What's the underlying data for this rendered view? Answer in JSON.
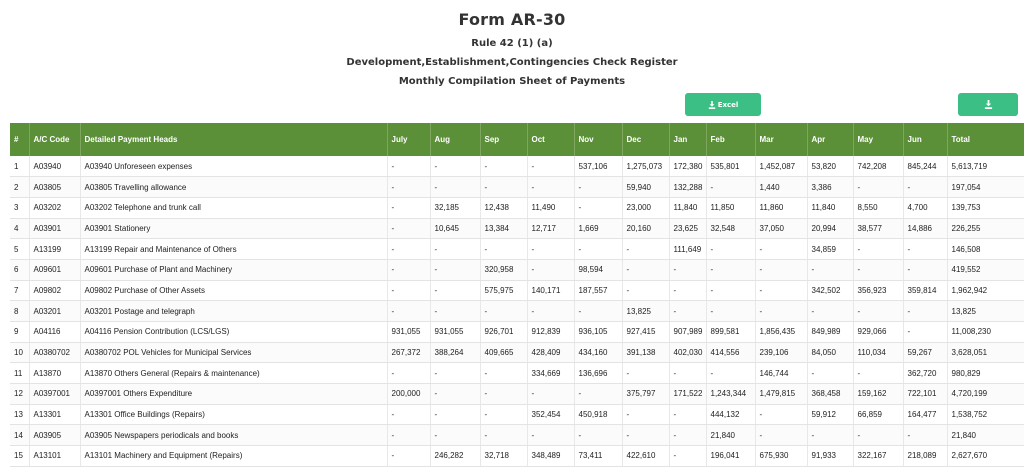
{
  "header": {
    "title": "Form AR-30",
    "rule": "Rule 42 (1) (a)",
    "register": "Development,Establishment,Contingencies Check Register",
    "sheet": "Monthly Compilation Sheet of Payments"
  },
  "toolbar": {
    "excel_label": "Excel",
    "excel_icon": "download-icon",
    "download_icon": "download-icon",
    "accent_color": "#3bbf84"
  },
  "table": {
    "header_color": "#5b8f38",
    "columns": [
      "#",
      "A/C Code",
      "Detailed Payment Heads",
      "July",
      "Aug",
      "Sep",
      "Oct",
      "Nov",
      "Dec",
      "Jan",
      "Feb",
      "Mar",
      "Apr",
      "May",
      "Jun",
      "Total"
    ],
    "rows": [
      [
        "1",
        "A03940",
        "A03940 Unforeseen expenses",
        "-",
        "-",
        "-",
        "-",
        "537,106",
        "1,275,073",
        "172,380",
        "535,801",
        "1,452,087",
        "53,820",
        "742,208",
        "845,244",
        "5,613,719"
      ],
      [
        "2",
        "A03805",
        "A03805 Travelling allowance",
        "-",
        "-",
        "-",
        "-",
        "-",
        "59,940",
        "132,288",
        "-",
        "1,440",
        "3,386",
        "-",
        "-",
        "197,054"
      ],
      [
        "3",
        "A03202",
        "A03202 Telephone and trunk call",
        "-",
        "32,185",
        "12,438",
        "11,490",
        "-",
        "23,000",
        "11,840",
        "11,850",
        "11,860",
        "11,840",
        "8,550",
        "4,700",
        "139,753"
      ],
      [
        "4",
        "A03901",
        "A03901 Stationery",
        "-",
        "10,645",
        "13,384",
        "12,717",
        "1,669",
        "20,160",
        "23,625",
        "32,548",
        "37,050",
        "20,994",
        "38,577",
        "14,886",
        "226,255"
      ],
      [
        "5",
        "A13199",
        "A13199 Repair and Maintenance of Others",
        "-",
        "-",
        "-",
        "-",
        "-",
        "-",
        "111,649",
        "-",
        "-",
        "34,859",
        "-",
        "-",
        "146,508"
      ],
      [
        "6",
        "A09601",
        "A09601 Purchase of Plant and Machinery",
        "-",
        "-",
        "320,958",
        "-",
        "98,594",
        "-",
        "-",
        "-",
        "-",
        "-",
        "-",
        "-",
        "419,552"
      ],
      [
        "7",
        "A09802",
        "A09802 Purchase of Other Assets",
        "-",
        "-",
        "575,975",
        "140,171",
        "187,557",
        "-",
        "-",
        "-",
        "-",
        "342,502",
        "356,923",
        "359,814",
        "1,962,942"
      ],
      [
        "8",
        "A03201",
        "A03201 Postage and telegraph",
        "-",
        "-",
        "-",
        "-",
        "-",
        "13,825",
        "-",
        "-",
        "-",
        "-",
        "-",
        "-",
        "13,825"
      ],
      [
        "9",
        "A04116",
        "A04116 Pension Contribution (LCS/LGS)",
        "931,055",
        "931,055",
        "926,701",
        "912,839",
        "936,105",
        "927,415",
        "907,989",
        "899,581",
        "1,856,435",
        "849,989",
        "929,066",
        "-",
        "11,008,230"
      ],
      [
        "10",
        "A0380702",
        "A0380702 POL Vehicles for Municipal Services",
        "267,372",
        "388,264",
        "409,665",
        "428,409",
        "434,160",
        "391,138",
        "402,030",
        "414,556",
        "239,106",
        "84,050",
        "110,034",
        "59,267",
        "3,628,051"
      ],
      [
        "11",
        "A13870",
        "A13870 Others General (Repairs & maintenance)",
        "-",
        "-",
        "-",
        "334,669",
        "136,696",
        "-",
        "-",
        "-",
        "146,744",
        "-",
        "-",
        "362,720",
        "980,829"
      ],
      [
        "12",
        "A0397001",
        "A0397001 Others Expenditure",
        "200,000",
        "-",
        "-",
        "-",
        "-",
        "375,797",
        "171,522",
        "1,243,344",
        "1,479,815",
        "368,458",
        "159,162",
        "722,101",
        "4,720,199"
      ],
      [
        "13",
        "A13301",
        "A13301 Office Buildings (Repairs)",
        "-",
        "-",
        "-",
        "352,454",
        "450,918",
        "-",
        "-",
        "444,132",
        "-",
        "59,912",
        "66,859",
        "164,477",
        "1,538,752"
      ],
      [
        "14",
        "A03905",
        "A03905 Newspapers periodicals and books",
        "-",
        "-",
        "-",
        "-",
        "-",
        "-",
        "-",
        "21,840",
        "-",
        "-",
        "-",
        "-",
        "21,840"
      ],
      [
        "15",
        "A13101",
        "A13101 Machinery and Equipment (Repairs)",
        "-",
        "246,282",
        "32,718",
        "348,489",
        "73,411",
        "422,610",
        "-",
        "196,041",
        "675,930",
        "91,933",
        "322,167",
        "218,089",
        "2,627,670"
      ]
    ]
  }
}
